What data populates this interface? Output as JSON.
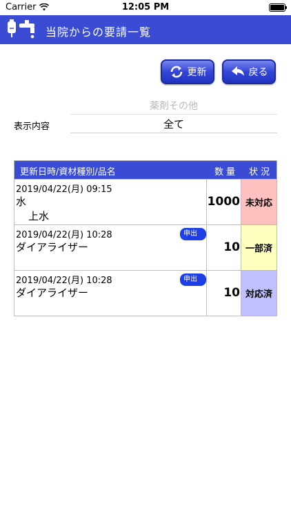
{
  "status_bar": {
    "carrier": "Carrier",
    "time": "12:05 PM"
  },
  "nav": {
    "title": "当院からの要請一覧",
    "icon": "iv-bag-faucet-icon"
  },
  "toolbar": {
    "refresh_label": "更新",
    "back_label": "戻る"
  },
  "filter": {
    "placeholder": "薬剤その他",
    "label": "表示内容",
    "value": "全て"
  },
  "table": {
    "headers": {
      "main": "更新日時/資材種別/品名",
      "qty": "数量",
      "status": "状況"
    },
    "rows": [
      {
        "date": "2019/04/22(月) 09:15",
        "type": "水",
        "item": "上水",
        "qty": "1000",
        "status": "未対応",
        "badge": "",
        "status_color": "#ffc0c0"
      },
      {
        "date": "2019/04/22(月) 10:28",
        "type": "ダイアライザー",
        "item": "",
        "qty": "10",
        "status": "一部済",
        "badge": "申出有",
        "status_color": "#ffffc0"
      },
      {
        "date": "2019/04/22(月) 10:28",
        "type": "ダイアライザー",
        "item": "",
        "qty": "10",
        "status": "対応済",
        "badge": "申出有",
        "status_color": "#c0c0ff"
      }
    ]
  },
  "colors": {
    "accent": "#3b4cd4",
    "badge": "#1e3ee6"
  }
}
